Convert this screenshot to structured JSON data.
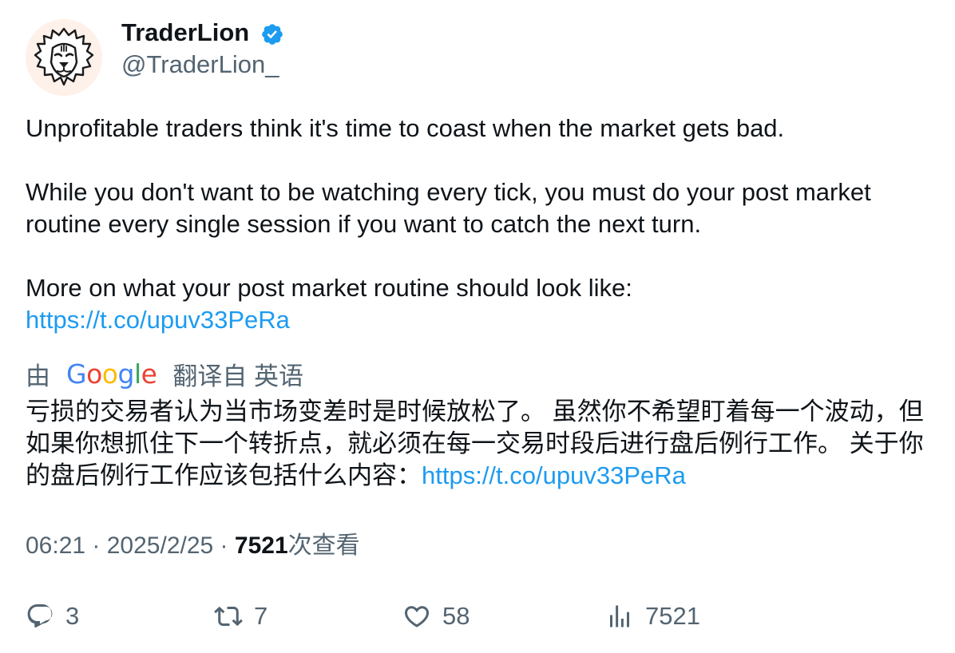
{
  "author": {
    "name": "TraderLion",
    "handle": "@TraderLion_",
    "avatar_icon": "lion-icon",
    "verified_icon": "verified-badge-icon",
    "verified_color": "#1d9bf0"
  },
  "tweet": {
    "paragraph1": "Unprofitable traders think it's time to coast when the market gets bad.",
    "paragraph2": "While you don't want to be watching every tick, you must do your post market routine every single session if you want to catch the next turn.",
    "paragraph3": "More on what your post market routine should look like:",
    "link": "https://t.co/upuv33PeRa"
  },
  "translation": {
    "prefix": "由",
    "provider": "Google",
    "suffix": "翻译自 英语",
    "text": "亏损的交易者认为当市场变差时是时候放松了。 虽然你不希望盯着每一个波动，但如果你想抓住下一个转折点，就必须在每一交易时段后进行盘后例行工作。 关于你的盘后例行工作应该包括什么内容：",
    "link": "https://t.co/upuv33PeRa"
  },
  "meta": {
    "time": "06:21",
    "separator": " · ",
    "date": "2025/2/25",
    "views_count": "7521",
    "views_label": "次查看"
  },
  "actions": {
    "replies": "3",
    "retweets": "7",
    "likes": "58",
    "views": "7521"
  },
  "colors": {
    "text": "#0f1419",
    "secondary": "#536471",
    "link": "#1d9bf0"
  }
}
